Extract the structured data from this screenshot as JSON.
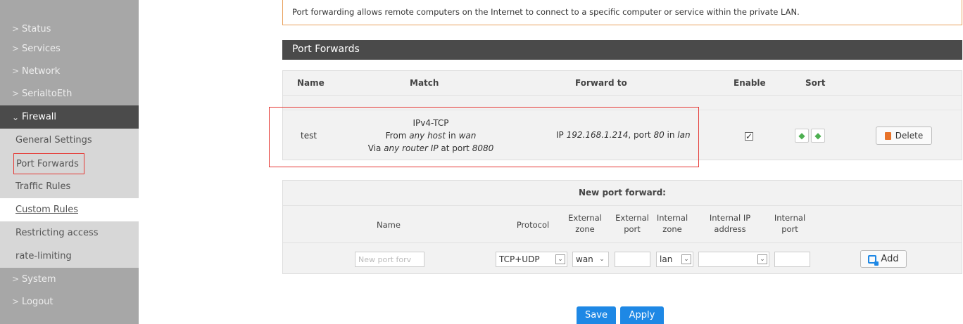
{
  "sidebar": {
    "items": [
      {
        "label": "Status"
      },
      {
        "label": "Services"
      },
      {
        "label": "Network"
      },
      {
        "label": "SerialtoEth"
      },
      {
        "label": "Firewall"
      },
      {
        "label": "System"
      },
      {
        "label": "Logout"
      }
    ],
    "firewall_sub": [
      {
        "label": "General Settings"
      },
      {
        "label": "Port Forwards"
      },
      {
        "label": "Traffic Rules"
      },
      {
        "label": "Custom Rules"
      },
      {
        "label": "Restricting access"
      },
      {
        "label": "rate-limiting"
      }
    ]
  },
  "intro_text": "Port forwarding allows remote computers on the Internet to connect to a specific computer or service within the private LAN.",
  "section_title": "Port Forwards",
  "table": {
    "headers": {
      "name": "Name",
      "match": "Match",
      "forward_to": "Forward to",
      "enable": "Enable",
      "sort": "Sort"
    },
    "row": {
      "name": "test",
      "match_proto": "IPv4-TCP",
      "match_from_prefix": "From ",
      "match_from_host": "any host",
      "match_from_mid": " in ",
      "match_from_zone": "wan",
      "match_via_prefix": "Via ",
      "match_via_router": "any router IP",
      "match_via_mid": " at port ",
      "match_via_port": "8080",
      "fwd_prefix": "IP ",
      "fwd_ip": "192.168.1.214",
      "fwd_mid": ", port ",
      "fwd_port": "80",
      "fwd_in": " in ",
      "fwd_zone": "lan",
      "enabled": true,
      "delete_label": "Delete"
    }
  },
  "new_forward": {
    "title": "New port forward:",
    "headers": {
      "name": "Name",
      "protocol": "Protocol",
      "ext_zone_1": "External",
      "ext_zone_2": "zone",
      "ext_port_1": "External",
      "ext_port_2": "port",
      "int_zone_1": "Internal",
      "int_zone_2": "zone",
      "int_ip_1": "Internal IP",
      "int_ip_2": "address",
      "int_port_1": "Internal",
      "int_port_2": "port"
    },
    "name_placeholder": "New port forv",
    "protocol_value": "TCP+UDP",
    "ext_zone_value": "wan",
    "int_zone_value": "lan",
    "add_label": "Add"
  },
  "footer": {
    "save_label": "Save",
    "apply_label": "Apply"
  },
  "icons": {
    "chevron": "chevron-right-icon",
    "delete": "trash-icon",
    "add": "add-icon"
  }
}
